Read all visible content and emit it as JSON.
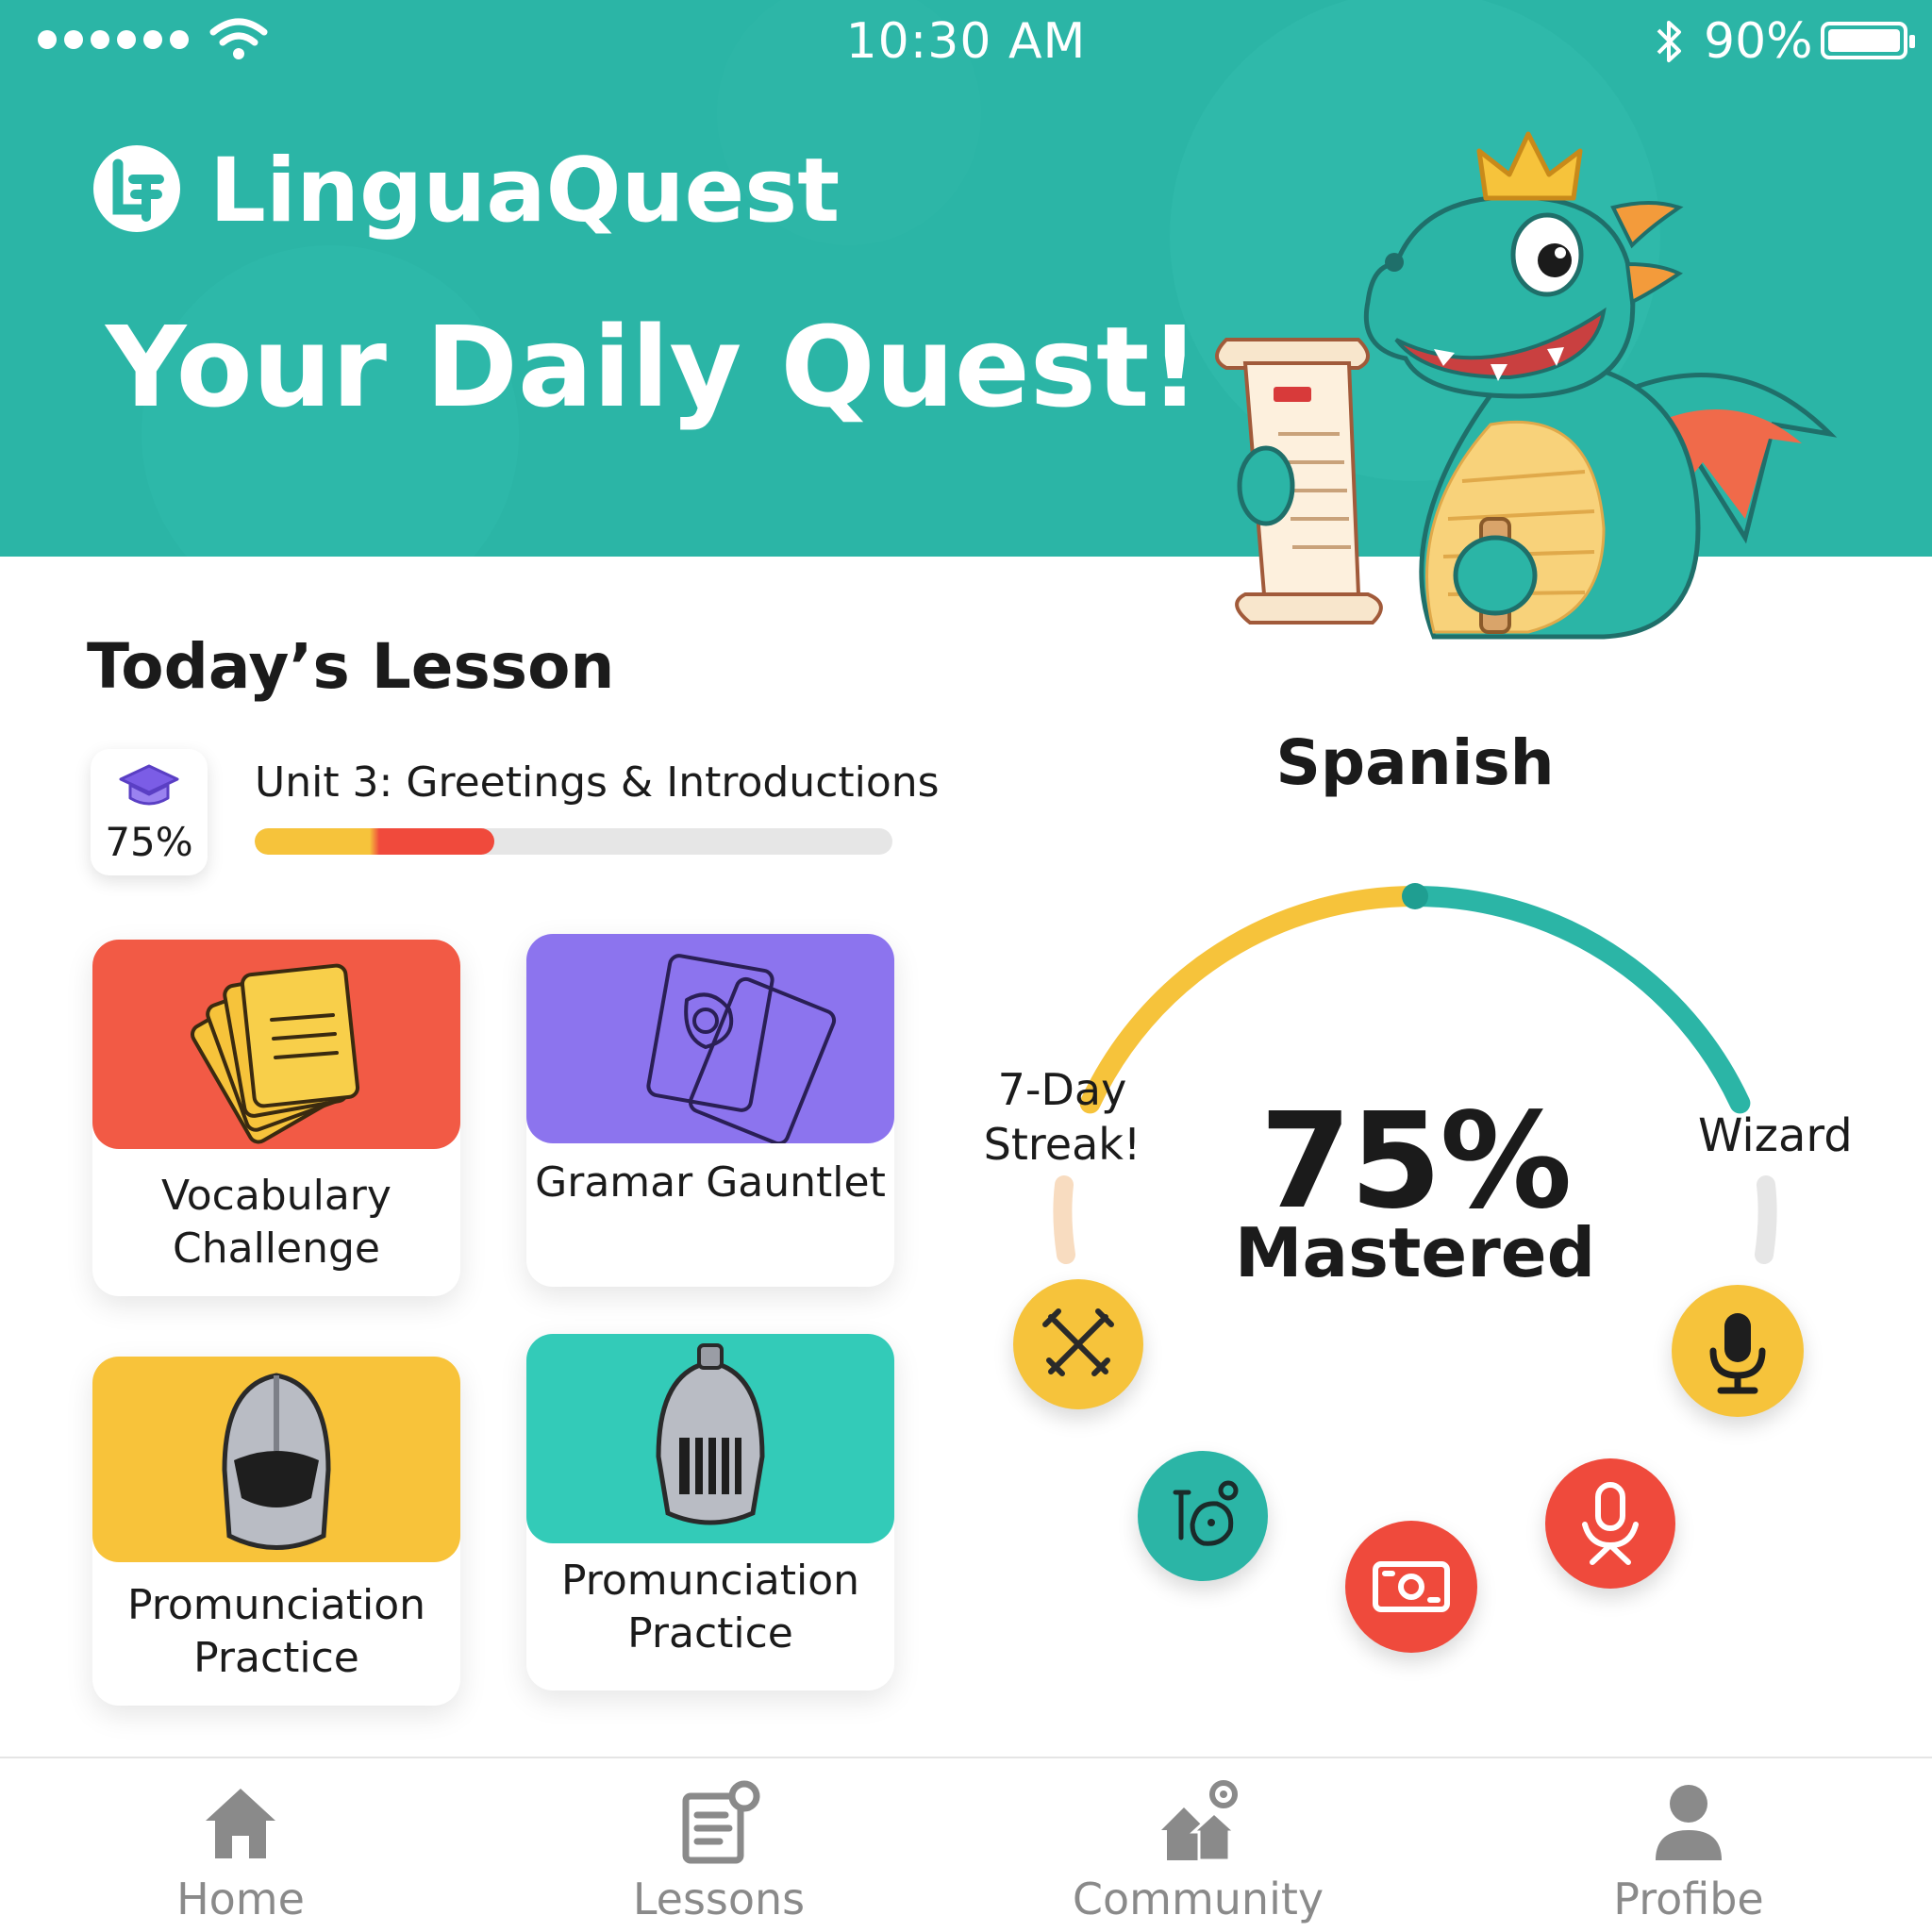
{
  "status_bar": {
    "time": "10:30 AM",
    "battery_percent": "90%",
    "battery_level": 0.9
  },
  "header": {
    "brand": "LinguaQuest",
    "tagline": "Your Daily Quest!",
    "mascot": "dragon-mascot",
    "color": "#2bb5a6"
  },
  "lesson": {
    "section_title": "Today’s Lesson",
    "unit_title": "Unit 3: Greetings & Introductions",
    "unit_percent": "75%",
    "progress": 0.375
  },
  "activities": [
    {
      "label": "Vocabulary Challenge",
      "icon": "flashcards-icon",
      "color": "#f25a45"
    },
    {
      "label": "Gramar Gauntlet",
      "icon": "cards-icon",
      "color": "#8c74ee"
    },
    {
      "label": "Promunciation Practice",
      "icon": "knight-helmet-icon",
      "color": "#f8c33a"
    },
    {
      "label": "Promunciation Practice",
      "icon": "knight-helmet-icon",
      "color": "#33cbb8"
    }
  ],
  "mastery": {
    "language": "Spanish",
    "percent": "75%",
    "percent_value": 0.75,
    "label": "Mastered",
    "left_badge": "7-Day Streak!",
    "right_badge": "Wizard",
    "colors": {
      "yellow": "#f6c33b",
      "teal": "#2bb5a6",
      "red": "#ef4a3c"
    }
  },
  "tabs": [
    {
      "label": "Home",
      "icon": "home-icon"
    },
    {
      "label": "Lessons",
      "icon": "lessons-icon"
    },
    {
      "label": "Community",
      "icon": "community-icon"
    },
    {
      "label": "Profibe",
      "icon": "profile-icon"
    }
  ]
}
